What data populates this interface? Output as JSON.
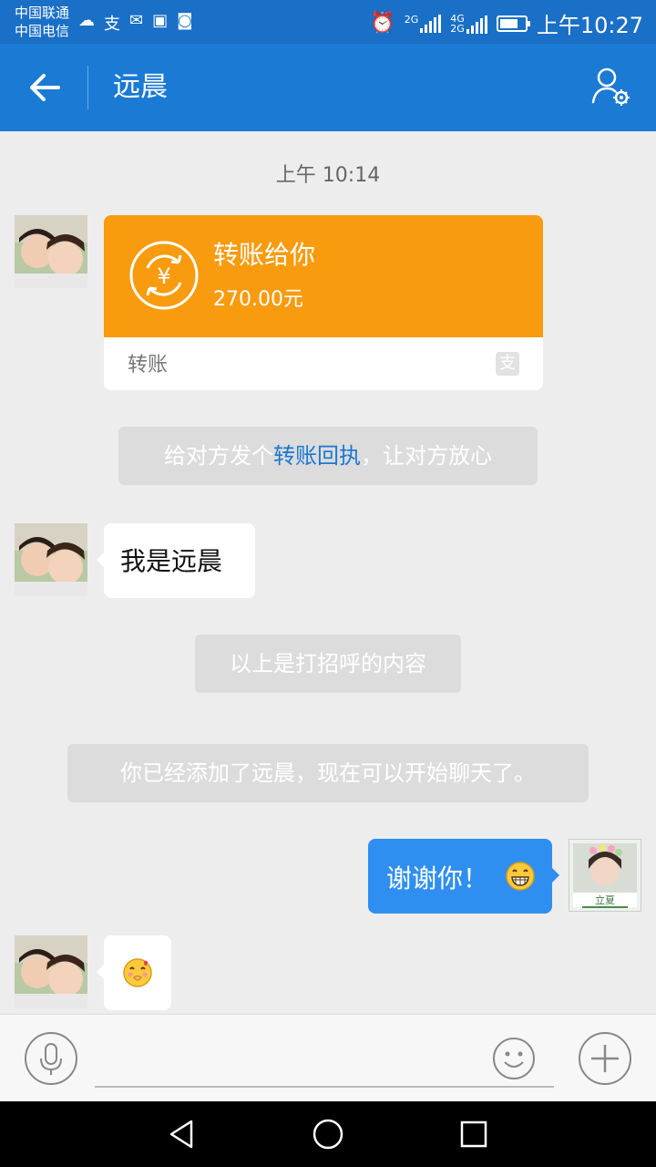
{
  "status_bar": {
    "carrier1": "中国联通",
    "carrier2": "中国电信",
    "net1": "2G",
    "net2_top": "4G",
    "net2_bottom": "2G",
    "time": "上午10:27",
    "battery_level": 0.75
  },
  "header": {
    "back_icon": "arrow-left-icon",
    "title": "远晨",
    "profile_icon": "person-settings-icon"
  },
  "chat": {
    "timestamp": "上午 10:14",
    "transfer": {
      "icon": "yen-refresh-icon",
      "title": "转账给你",
      "amount": "270.00元",
      "footer_label": "转账",
      "brand_icon": "alipay-icon"
    },
    "receipt_notice": {
      "prefix": "给对方发个",
      "link": "转账回执",
      "suffix": "，让对方放心"
    },
    "incoming_text": "我是远晨",
    "greeting_notice": "以上是打招呼的内容",
    "added_notice": "你已经添加了远晨，现在可以开始聊天了。",
    "outgoing_text": "谢谢你！",
    "outgoing_emoji_icon": "grin-emoji-icon",
    "own_avatar_caption": "立夏",
    "incoming_emoji_icon": "kiss-emoji-icon"
  },
  "input_bar": {
    "voice_icon": "microphone-icon",
    "emoji_icon": "smiley-icon",
    "plus_icon": "plus-icon"
  },
  "nav_bar": {
    "back_icon": "triangle-back-icon",
    "home_icon": "circle-home-icon",
    "recents_icon": "square-recents-icon"
  },
  "colors": {
    "header_bg": "#1b7ad4",
    "transfer_orange": "#f89b0f",
    "outgoing_bubble": "#2f8ff0",
    "link_blue": "#1a78d0"
  }
}
